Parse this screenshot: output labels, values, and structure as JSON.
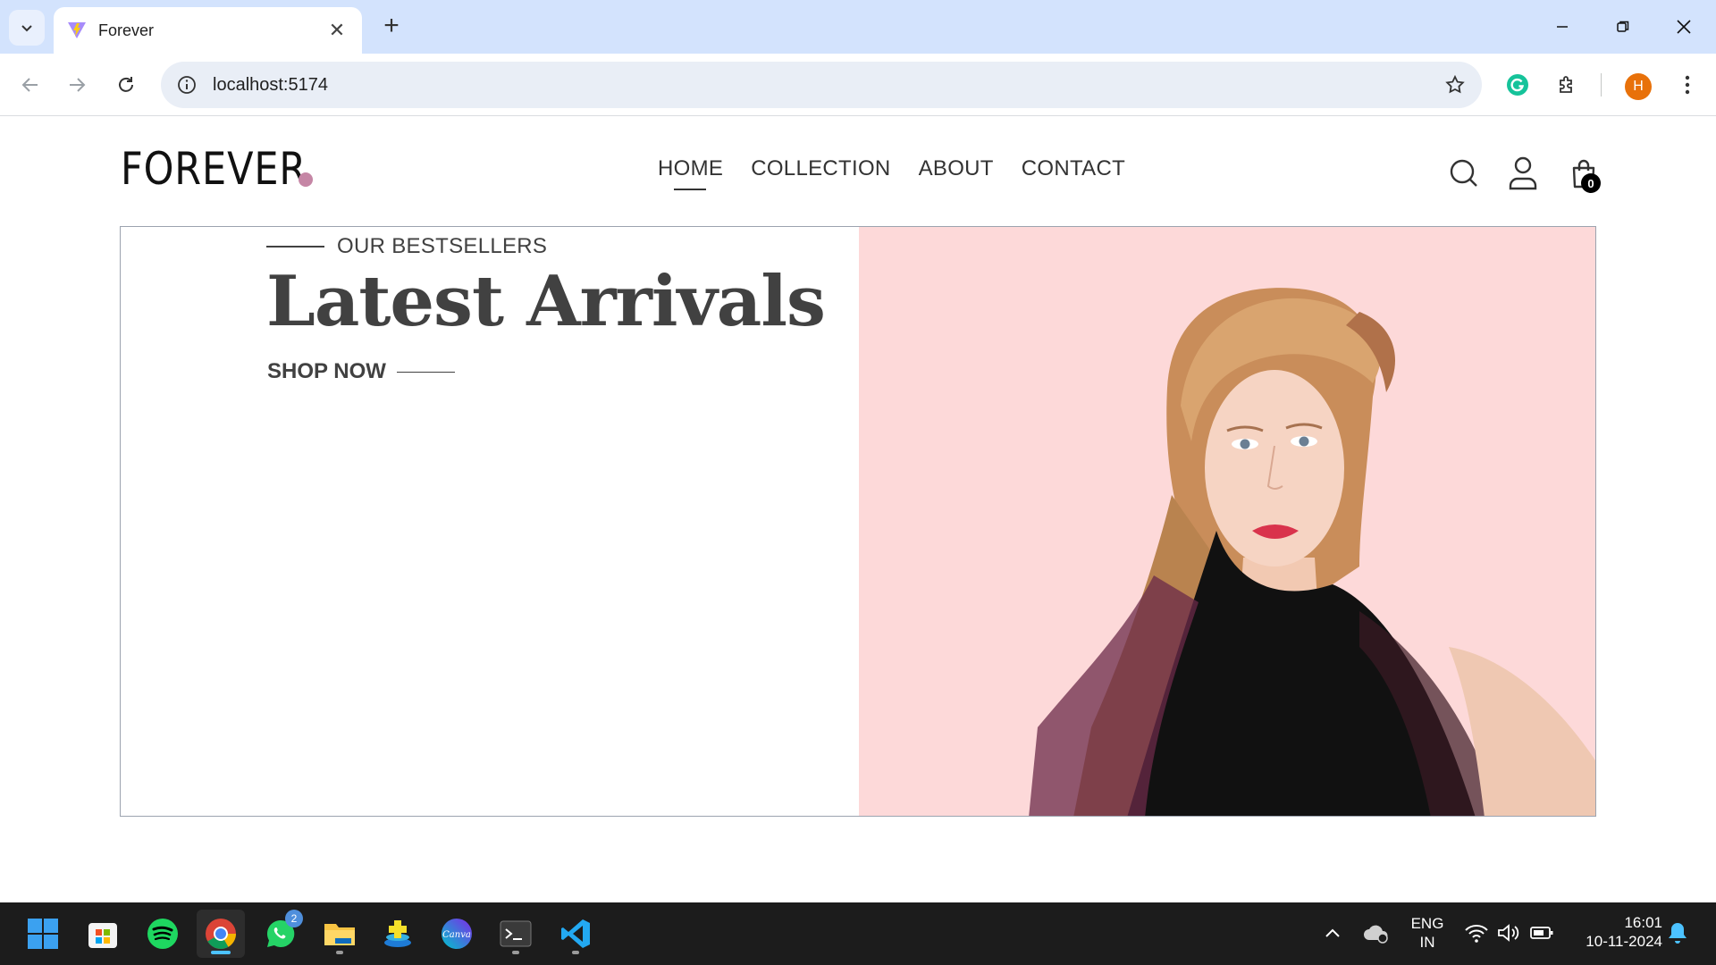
{
  "browser": {
    "tab_title": "Forever",
    "url": "localhost:5174",
    "profile_initial": "H"
  },
  "site": {
    "logo_text": "FOREVER",
    "accent_color": "#c586a5",
    "nav": [
      {
        "label": "HOME"
      },
      {
        "label": "COLLECTION"
      },
      {
        "label": "ABOUT"
      },
      {
        "label": "CONTACT"
      }
    ],
    "cart_count": "0"
  },
  "hero": {
    "eyebrow": "OUR BESTSELLERS",
    "title": "Latest Arrivals",
    "cta": "SHOP NOW",
    "image_background": "#fdd9d9"
  },
  "taskbar": {
    "whatsapp_badge": "2",
    "lang_line1": "ENG",
    "lang_line2": "IN",
    "time": "16:01",
    "date": "10-11-2024"
  }
}
